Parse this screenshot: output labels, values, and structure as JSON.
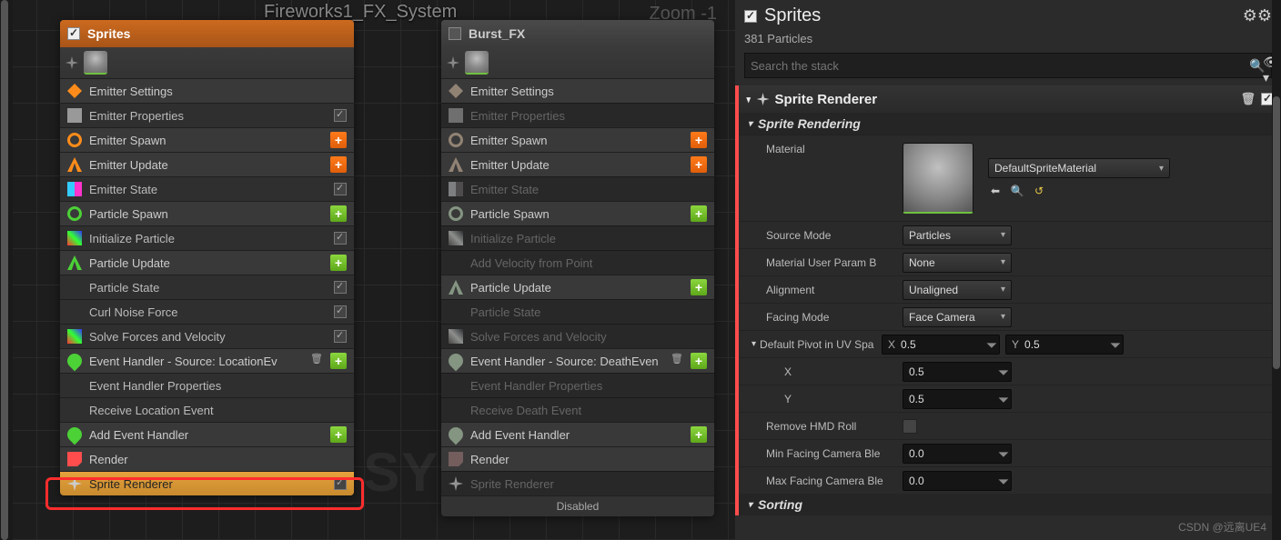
{
  "system_title": "Fireworks1_FX_System",
  "zoom_label": "Zoom -1",
  "watermark_text": "SYSTEM",
  "csdn_watermark": "CSDN @远离UE4",
  "emitter1": {
    "name": "Sprites",
    "sections": [
      {
        "icon": "i-es",
        "label": "Emitter Settings",
        "type": "head"
      },
      {
        "icon": "i-cpu",
        "label": "Emitter Properties",
        "type": "item",
        "check": true
      },
      {
        "icon": "i-spawn",
        "label": "Emitter Spawn",
        "type": "head",
        "add": "orange"
      },
      {
        "icon": "i-upd",
        "label": "Emitter Update",
        "type": "head",
        "add": "orange"
      },
      {
        "icon": "i-state",
        "label": "Emitter State",
        "type": "item",
        "check": true
      },
      {
        "icon": "i-ps",
        "label": "Particle Spawn",
        "type": "head",
        "add": "green"
      },
      {
        "icon": "i-init",
        "label": "Initialize Particle",
        "type": "item",
        "check": true
      },
      {
        "icon": "i-pu",
        "label": "Particle Update",
        "type": "head",
        "add": "green"
      },
      {
        "icon": "",
        "label": "Particle State",
        "type": "item",
        "check": true
      },
      {
        "icon": "",
        "label": "Curl Noise Force",
        "type": "item",
        "check": true,
        "extra": true
      },
      {
        "icon": "i-init",
        "label": "Solve Forces and Velocity",
        "type": "item",
        "check": true
      },
      {
        "icon": "i-eh",
        "label": "Event Handler - Source: LocationEv",
        "type": "head",
        "add": "green",
        "trash": true
      },
      {
        "icon": "",
        "label": "Event Handler Properties",
        "type": "item"
      },
      {
        "icon": "",
        "label": "Receive Location Event",
        "type": "item"
      },
      {
        "icon": "i-eh",
        "label": "Add Event Handler",
        "type": "head",
        "add": "green"
      },
      {
        "icon": "i-rend",
        "label": "Render",
        "type": "head"
      },
      {
        "icon": "i-spr",
        "label": "Sprite Renderer",
        "type": "item",
        "check": true,
        "selected": true
      }
    ]
  },
  "emitter2": {
    "name": "Burst_FX",
    "disabled_label": "Disabled",
    "sections": [
      {
        "icon": "i-es",
        "label": "Emitter Settings",
        "type": "head"
      },
      {
        "icon": "i-cpu",
        "label": "Emitter Properties",
        "type": "item",
        "faded": true
      },
      {
        "icon": "i-spawn",
        "label": "Emitter Spawn",
        "type": "head",
        "add": "orange"
      },
      {
        "icon": "i-upd",
        "label": "Emitter Update",
        "type": "head",
        "add": "orange"
      },
      {
        "icon": "i-state",
        "label": "Emitter State",
        "type": "item",
        "faded": true
      },
      {
        "icon": "i-ps",
        "label": "Particle Spawn",
        "type": "head",
        "add": "green"
      },
      {
        "icon": "i-init",
        "label": "Initialize Particle",
        "type": "item",
        "faded": true
      },
      {
        "icon": "",
        "label": "Add Velocity from Point",
        "type": "item",
        "faded": true
      },
      {
        "icon": "i-pu",
        "label": "Particle Update",
        "type": "head",
        "add": "green"
      },
      {
        "icon": "",
        "label": "Particle State",
        "type": "item",
        "faded": true
      },
      {
        "icon": "i-init",
        "label": "Solve Forces and Velocity",
        "type": "item",
        "faded": true
      },
      {
        "icon": "i-eh",
        "label": "Event Handler - Source: DeathEven",
        "type": "head",
        "add": "green",
        "trash": true
      },
      {
        "icon": "",
        "label": "Event Handler Properties",
        "type": "item",
        "faded": true
      },
      {
        "icon": "",
        "label": "Receive Death Event",
        "type": "item",
        "faded": true
      },
      {
        "icon": "i-eh",
        "label": "Add Event Handler",
        "type": "head",
        "add": "green"
      },
      {
        "icon": "i-rend",
        "label": "Render",
        "type": "head"
      },
      {
        "icon": "i-spr",
        "label": "Sprite Renderer",
        "type": "item",
        "faded": true
      }
    ]
  },
  "details": {
    "title": "Sprites",
    "particle_count": "381 Particles",
    "search_placeholder": "Search the stack",
    "category_title": "Sprite Renderer",
    "section_title": "Sprite Rendering",
    "sorting_title": "Sorting",
    "material_label": "Material",
    "material_value": "DefaultSpriteMaterial",
    "props": {
      "source_mode": {
        "label": "Source Mode",
        "value": "Particles"
      },
      "mat_user": {
        "label": "Material User Param B",
        "value": "None"
      },
      "alignment": {
        "label": "Alignment",
        "value": "Unaligned"
      },
      "facing": {
        "label": "Facing Mode",
        "value": "Face Camera"
      },
      "pivot": {
        "label": "Default Pivot in UV Spa",
        "x": "0.5",
        "y": "0.5",
        "xl": "X",
        "yl": "Y"
      },
      "pivot_x": {
        "label": "X",
        "value": "0.5"
      },
      "pivot_y": {
        "label": "Y",
        "value": "0.5"
      },
      "hmd": {
        "label": "Remove HMD Roll"
      },
      "min_blend": {
        "label": "Min Facing Camera Ble",
        "value": "0.0"
      },
      "max_blend": {
        "label": "Max Facing Camera Ble",
        "value": "0.0"
      }
    }
  }
}
